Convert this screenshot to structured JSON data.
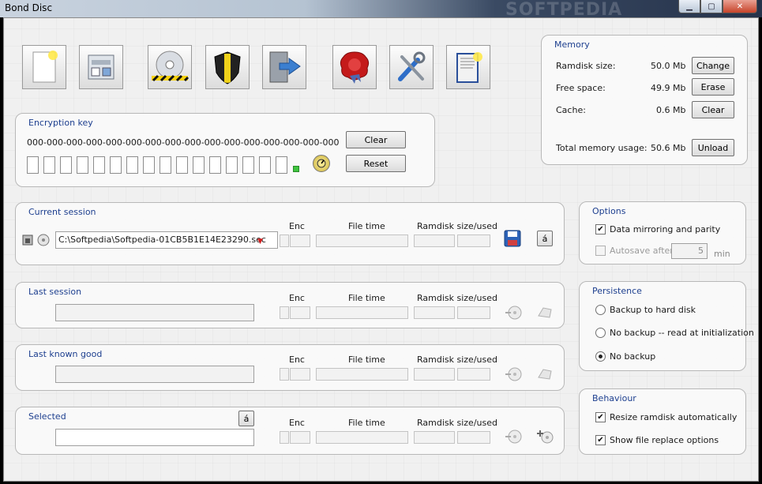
{
  "window": {
    "title": "Bond Disc",
    "watermark": "SOFTPEDIA"
  },
  "toolbar": [
    {
      "name": "new-key-button",
      "icon": "new-document-icon"
    },
    {
      "name": "open-key-button",
      "icon": "drive-icon"
    },
    {
      "name": "burn-disc-button",
      "icon": "disc-icon"
    },
    {
      "name": "protect-button",
      "icon": "shield-icon"
    },
    {
      "name": "import-button",
      "icon": "import-icon"
    },
    {
      "name": "seal-button",
      "icon": "wax-seal-icon"
    },
    {
      "name": "settings-button",
      "icon": "tools-icon"
    },
    {
      "name": "help-button",
      "icon": "book-icon"
    }
  ],
  "encryption": {
    "title": "Encryption key",
    "key": "000-000-000-000-000-000-000-000-000-000-000-000-000-000-000-000",
    "clear_label": "Clear",
    "reset_label": "Reset"
  },
  "memory": {
    "title": "Memory",
    "ramdisk_label": "Ramdisk size:",
    "ramdisk_value": "50.0 Mb",
    "change_label": "Change",
    "free_label": "Free space:",
    "free_value": "49.9 Mb",
    "erase_label": "Erase",
    "cache_label": "Cache:",
    "cache_value": "0.6 Mb",
    "clear_label": "Clear",
    "total_label": "Total memory usage:",
    "total_value": "50.6 Mb",
    "unload_label": "Unload"
  },
  "columns": {
    "enc": "Enc",
    "file_time": "File time",
    "ramdisk": "Ramdisk size/used"
  },
  "current_session": {
    "title": "Current session",
    "path": "C:\\Softpedia\\Softpedia-01CB5B1E14E23290.sec",
    "button_glyph": "á"
  },
  "last_session": {
    "title": "Last session"
  },
  "last_known_good": {
    "title": "Last known good"
  },
  "selected": {
    "title": "Selected",
    "button_glyph": "á"
  },
  "options": {
    "title": "Options",
    "mirror_label": "Data mirroring and parity",
    "mirror_checked": "✔",
    "autosave_label": "Autosave after",
    "autosave_value": "5",
    "autosave_unit": "min"
  },
  "persistence": {
    "title": "Persistence",
    "opt1": "Backup to hard disk",
    "opt2": "No backup -- read at initialization",
    "opt3": "No backup"
  },
  "behaviour": {
    "title": "Behaviour",
    "resize_label": "Resize ramdisk automatically",
    "replace_label": "Show file replace options",
    "checked": "✔"
  }
}
